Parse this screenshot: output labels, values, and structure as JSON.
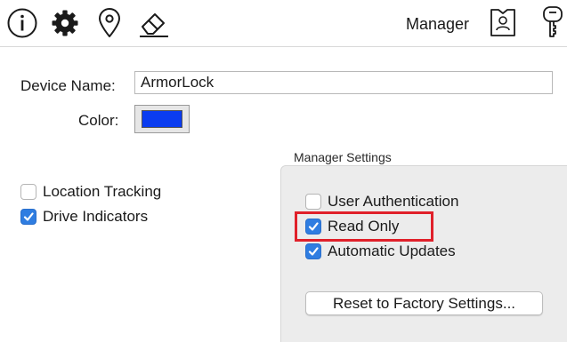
{
  "toolbar": {
    "items": [
      {
        "icon": "info-icon"
      },
      {
        "icon": "gear-icon"
      },
      {
        "icon": "location-pin-icon"
      },
      {
        "icon": "eraser-icon"
      }
    ],
    "manager_label": "Manager",
    "manager_icon": "manager-badge-icon",
    "key_icon": "key-icon"
  },
  "form": {
    "device_name_label": "Device Name:",
    "device_name_value": "ArmorLock",
    "color_label": "Color:",
    "color_value": "#0a3cf0"
  },
  "options": {
    "location_tracking": {
      "label": "Location Tracking",
      "checked": false
    },
    "drive_indicators": {
      "label": "Drive Indicators",
      "checked": true
    }
  },
  "manager_settings": {
    "title": "Manager Settings",
    "user_authentication": {
      "label": "User Authentication",
      "checked": false
    },
    "read_only": {
      "label": "Read Only",
      "checked": true,
      "highlighted": true
    },
    "automatic_updates": {
      "label": "Automatic Updates",
      "checked": true
    },
    "reset_button_label": "Reset to Factory Settings..."
  },
  "colors": {
    "checkbox_accent": "#2f7de1",
    "highlight_border": "#e0202a",
    "group_background": "#ececec"
  }
}
